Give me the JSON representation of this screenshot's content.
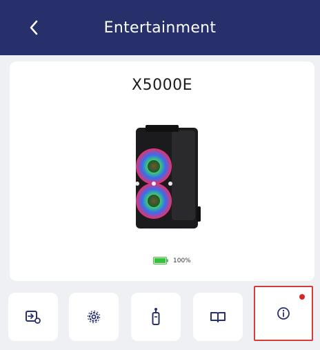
{
  "header": {
    "title": "Entertainment",
    "back_icon": "chevron-left-icon"
  },
  "device": {
    "model": "X5000E",
    "battery_percent": 100,
    "battery_label": "100%"
  },
  "toolbar": {
    "items": [
      {
        "icon": "input-source-icon"
      },
      {
        "icon": "settings-gear-icon"
      },
      {
        "icon": "light-tower-icon"
      },
      {
        "icon": "manual-book-icon"
      },
      {
        "icon": "info-icon",
        "has_badge": true
      }
    ]
  },
  "colors": {
    "header_bg": "#27306b",
    "battery_green": "#35c23a",
    "badge_red": "#d42828",
    "highlight_border": "#d43b3b"
  }
}
